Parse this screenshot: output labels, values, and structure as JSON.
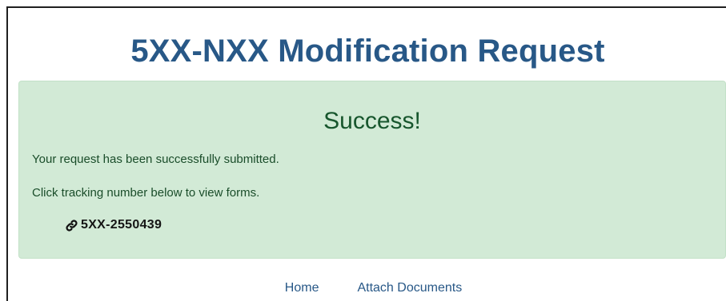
{
  "page": {
    "title": "5XX-NXX Modification Request"
  },
  "alert": {
    "heading": "Success!",
    "message": "Your request has been successfully submitted.",
    "instruction": "Click tracking number below to view forms.",
    "tracking_icon": "link-icon",
    "tracking_number": "5XX-2550439"
  },
  "nav": {
    "links": [
      {
        "label": "Home"
      },
      {
        "label": "Attach Documents"
      }
    ]
  },
  "colors": {
    "title": "#285887",
    "alert_background": "#d2ead6",
    "alert_text": "#17562d",
    "link": "#285887"
  }
}
